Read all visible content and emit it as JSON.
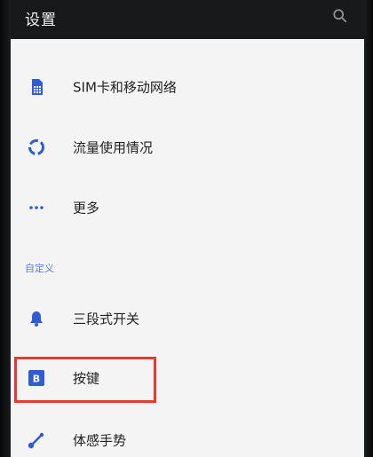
{
  "header": {
    "title": "设置",
    "search_icon": "search-icon"
  },
  "list": {
    "items": [
      {
        "label": "SIM卡和移动网络",
        "icon": "sim-card-icon"
      },
      {
        "label": "流量使用情况",
        "icon": "data-usage-icon"
      },
      {
        "label": "更多",
        "icon": "more-dots-icon"
      }
    ],
    "section_title": "自定义",
    "custom_items": [
      {
        "label": "三段式开关",
        "icon": "bell-icon"
      },
      {
        "label": "按键",
        "icon": "button-b-icon"
      },
      {
        "label": "体感手势",
        "icon": "gesture-icon"
      }
    ]
  },
  "colors": {
    "accent": "#2f5bd3",
    "highlight": "#e53935",
    "background": "#f4f4f4"
  }
}
